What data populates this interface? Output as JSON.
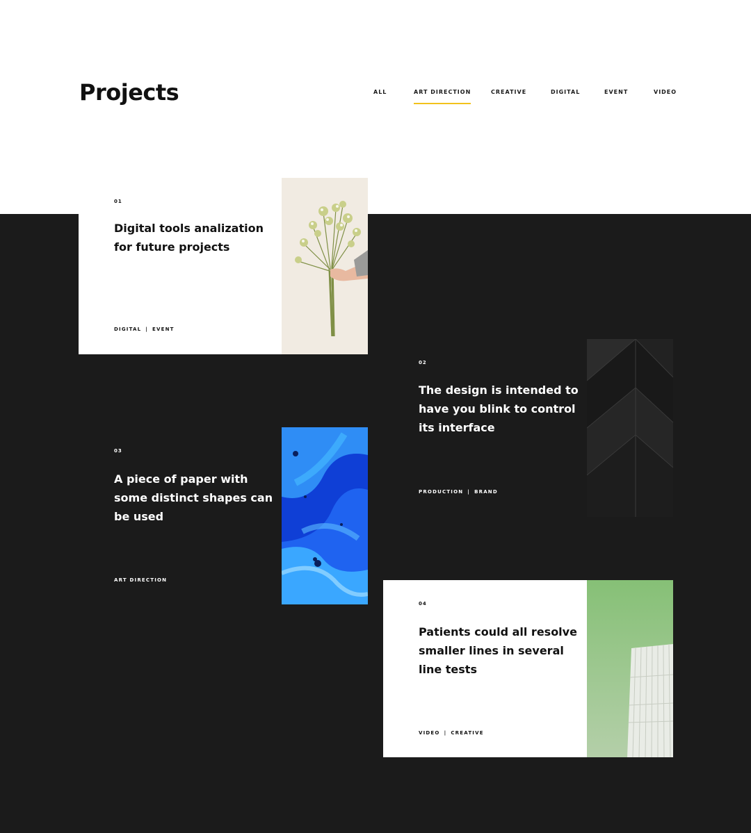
{
  "page": {
    "title": "Projects"
  },
  "filters": [
    {
      "label": "ALL",
      "active": false
    },
    {
      "label": "ART DIRECTION",
      "active": true
    },
    {
      "label": "CREATIVE",
      "active": false
    },
    {
      "label": "DIGITAL",
      "active": false
    },
    {
      "label": "EVENT",
      "active": false
    },
    {
      "label": "VIDEO",
      "active": false
    }
  ],
  "projects": [
    {
      "number": "01",
      "title": "Digital tools analization for future projects",
      "tags": [
        "DIGITAL",
        "EVENT"
      ],
      "image": "flower-bouquet-image",
      "theme": "light"
    },
    {
      "number": "02",
      "title": "The design is intended to have you blink to control its interface",
      "tags": [
        "PRODUCTION",
        "BRAND"
      ],
      "image": "dark-architecture-image",
      "theme": "dark"
    },
    {
      "number": "03",
      "title": "A piece of paper with some distinct shapes can be used",
      "tags": [
        "ART DIRECTION"
      ],
      "image": "blue-fluid-art-image",
      "theme": "dark"
    },
    {
      "number": "04",
      "title": "Patients could all resolve smaller lines in several line tests",
      "tags": [
        "VIDEO",
        "CREATIVE"
      ],
      "image": "green-sky-building-image",
      "theme": "light"
    }
  ],
  "colors": {
    "background_light": "#ffffff",
    "background_dark": "#1b1b1b",
    "accent": "#f2c21b",
    "text_dark": "#111111",
    "text_light": "#ffffff"
  }
}
